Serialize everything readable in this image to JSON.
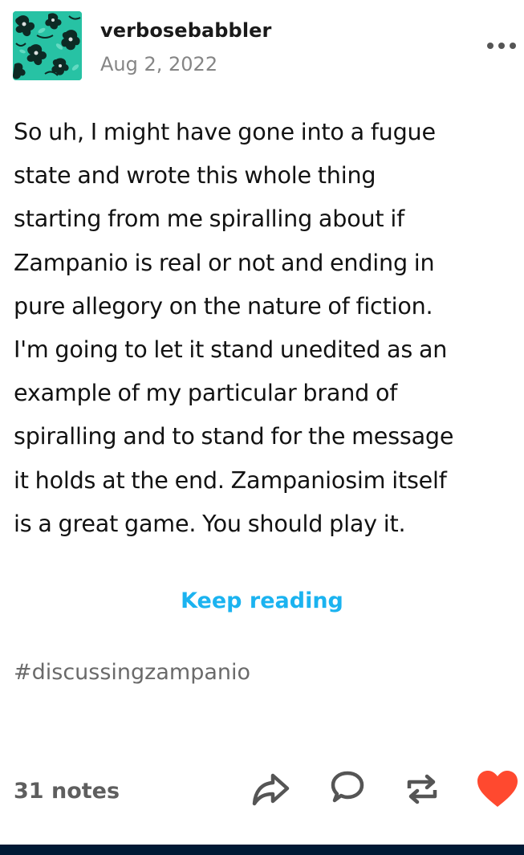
{
  "post": {
    "author": "verbosebabbler",
    "date": "Aug 2, 2022",
    "body_lines": [
      "So uh, I might have gone into a fugue",
      "state and wrote this whole thing",
      "starting from me spiralling about if",
      "Zampanio is real or not and ending in",
      "pure allegory on the nature of fiction.",
      "I'm going to let it stand unedited as an",
      "example of my particular brand of",
      "spiralling and to stand for the message",
      "it holds at the end. Zampaniosim itself",
      "is a great game. You should play it."
    ],
    "keep_reading_label": "Keep reading",
    "tag": "#discussingzampanio"
  },
  "footer": {
    "notes": "31 notes",
    "actions": [
      {
        "name": "share",
        "icon": "share-icon"
      },
      {
        "name": "reply",
        "icon": "reply-icon"
      },
      {
        "name": "reblog",
        "icon": "reblog-icon"
      },
      {
        "name": "like",
        "icon": "heart-icon",
        "liked": true
      }
    ]
  },
  "colors": {
    "link_blue": "#1bb3f0",
    "like_red": "#ff492f",
    "date_gray": "#858585",
    "tag_gray": "#6a6a6a",
    "bottom_bar": "#001935",
    "avatar_teal": "#27c2a4"
  }
}
